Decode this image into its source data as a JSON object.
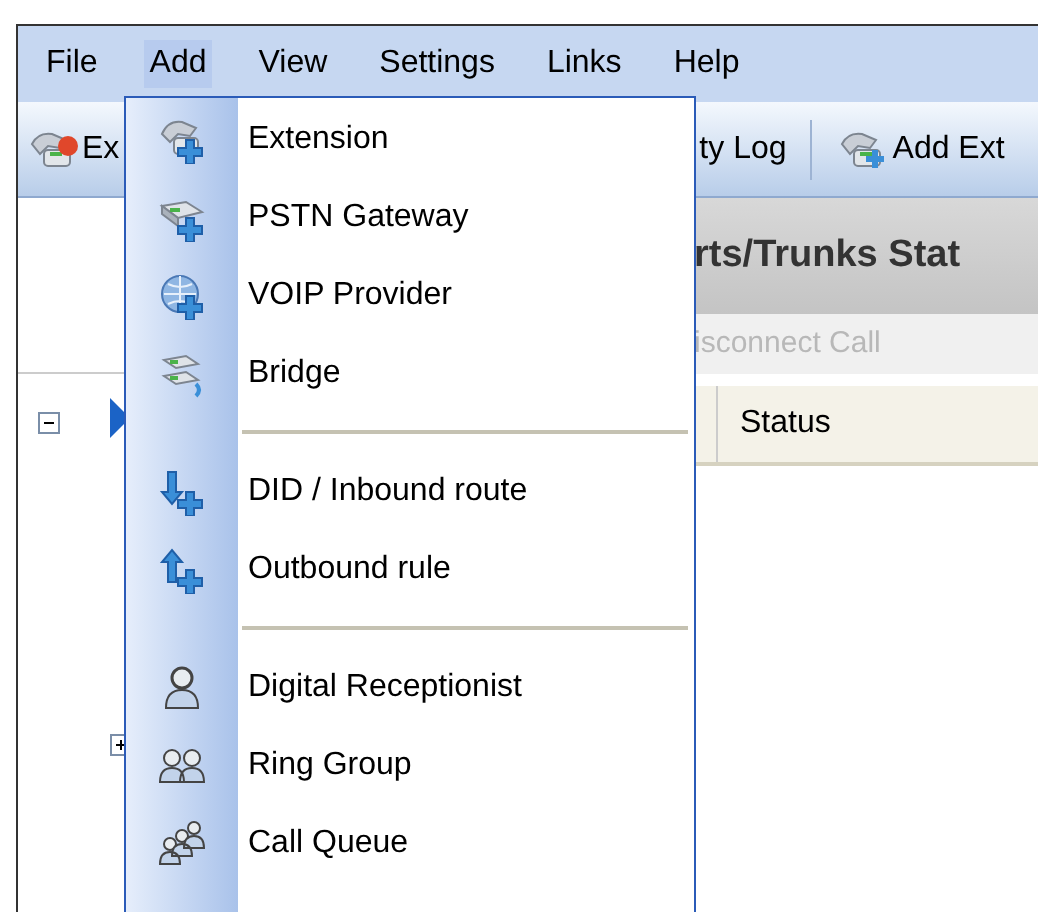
{
  "menubar": [
    {
      "label": "File",
      "selected": false
    },
    {
      "label": "Add",
      "selected": true
    },
    {
      "label": "View",
      "selected": false
    },
    {
      "label": "Settings",
      "selected": false
    },
    {
      "label": "Links",
      "selected": false
    },
    {
      "label": "Help",
      "selected": false
    }
  ],
  "toolbar": [
    {
      "label": "Ex"
    },
    {
      "label": "ty Log"
    },
    {
      "label": "Add Ext"
    }
  ],
  "panel": {
    "title": "rts/Trunks Stat",
    "action": {
      "label": "isconnect Call",
      "disabled": true
    },
    "columns": [
      "Status"
    ]
  },
  "tree": [
    {
      "expanded": true
    },
    {
      "expanded": false
    }
  ],
  "dropdown": [
    {
      "kind": "item",
      "label": "Extension"
    },
    {
      "kind": "item",
      "label": "PSTN Gateway"
    },
    {
      "kind": "item",
      "label": "VOIP Provider"
    },
    {
      "kind": "item",
      "label": "Bridge"
    },
    {
      "kind": "separator"
    },
    {
      "kind": "item",
      "label": "DID / Inbound route"
    },
    {
      "kind": "item",
      "label": "Outbound rule"
    },
    {
      "kind": "separator"
    },
    {
      "kind": "item",
      "label": "Digital Receptionist"
    },
    {
      "kind": "item",
      "label": "Ring Group"
    },
    {
      "kind": "item",
      "label": "Call Queue"
    }
  ]
}
